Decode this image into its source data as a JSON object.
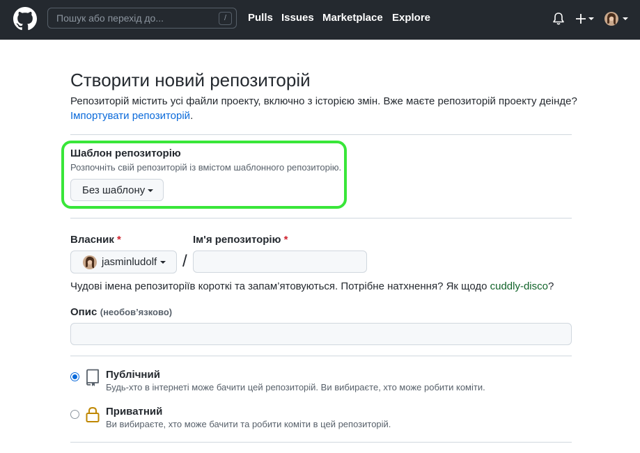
{
  "header": {
    "search_placeholder": "Пошук або перехід до...",
    "search_key": "/",
    "nav": [
      "Pulls",
      "Issues",
      "Marketplace",
      "Explore"
    ]
  },
  "page": {
    "title": "Створити новий репозиторій",
    "subtitle": "Репозиторій містить усі файли проекту, включно з історією змін. Вже маєте репозиторій проекту деінде?",
    "import_link": "Імпортувати репозиторій",
    "import_suffix": "."
  },
  "template": {
    "label": "Шаблон репозиторію",
    "description": "Розпочніть свій репозиторій із вмістом шаблонного репозиторію.",
    "selected": "Без шаблону"
  },
  "owner": {
    "label": "Власник",
    "required_mark": "*",
    "value": "jasminludolf"
  },
  "repo_name": {
    "label": "Ім'я репозиторію",
    "required_mark": "*",
    "value": "",
    "separator": "/"
  },
  "hint": {
    "text": "Чудові імена репозиторіїв короткі та запам’ятовуються. Потрібне натхнення? Як щодо ",
    "suggestion": "cuddly-disco",
    "suffix": "?"
  },
  "description": {
    "label": "Опис",
    "optional": "(необов’язково)",
    "value": ""
  },
  "visibility": [
    {
      "title": "Публічний",
      "desc": "Будь-хто в інтернеті може бачити цей репозиторій. Ви вибираєте, хто може робити коміти.",
      "selected": true
    },
    {
      "title": "Приватний",
      "desc": "Ви вибираєте, хто може бачити та робити коміти в цей репозиторій.",
      "selected": false
    }
  ],
  "colors": {
    "header_bg": "#24292f",
    "link": "#0969da",
    "suggestion": "#116329",
    "highlight": "#39e639",
    "required": "#cf222e"
  }
}
